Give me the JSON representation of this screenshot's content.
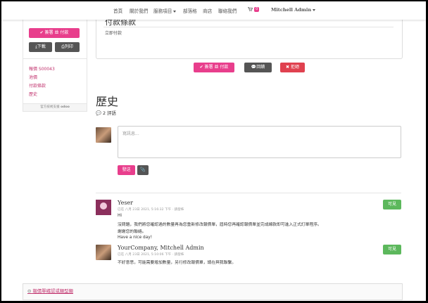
{
  "nav": {
    "items": [
      "首頁",
      "關於我們",
      "服務項目",
      "部落格",
      "商店",
      "聯絡我們"
    ],
    "cart_count": "0",
    "user": "Mitchell Admin"
  },
  "sidebar": {
    "sign_pay": "簽署 並 付款",
    "download": "下載",
    "print": "列印",
    "links": [
      "報價 S00043",
      "池價",
      "付款條款",
      "歷史"
    ],
    "footer_prefix": "官方技術支援",
    "footer_brand": "odoo"
  },
  "panel": {
    "title": "付款條款",
    "text": "立即付款"
  },
  "actions": {
    "sign_pay": "簽署 並 付款",
    "feedback": "回饋",
    "reject": "拒絕"
  },
  "history": {
    "title": "歷史",
    "count": "2 評語",
    "placeholder": "寫訊息...",
    "send": "發送"
  },
  "messages": [
    {
      "author": "Yeser",
      "meta": "已在 八月 23日 2021, 5:16:32 下午 · 請發佈",
      "lines": [
        "Hi",
        "沒問題，我們將您確認過的數量再為您重新修改報價單，屆時您再確認報價單並完成線款即可進入正式訂單程序。",
        "謝謝您的聯絡。",
        "Have a nice day!"
      ],
      "badge": "可見"
    },
    {
      "author": "YourCompany, Mitchell Admin",
      "meta": "已在 八月 23日 2021, 5:10:06 下午 · 請發佈",
      "lines": [
        "不好意思，可能需要增加數量，另行修改報價單，請在與我聯繫。"
      ],
      "badge": "可見"
    }
  ],
  "bottom": {
    "link": "報價單確認或類型類"
  }
}
